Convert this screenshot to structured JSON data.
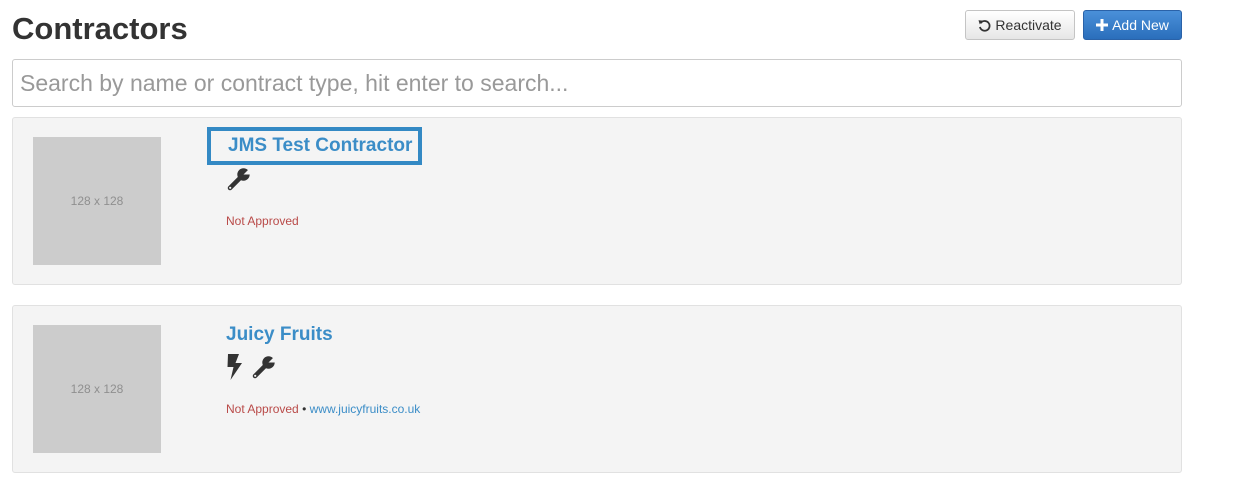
{
  "header": {
    "title": "Contractors",
    "reactivate_label": "Reactivate",
    "add_new_label": "Add New"
  },
  "search": {
    "placeholder": "Search by name or contract type, hit enter to search...",
    "value": ""
  },
  "contractors": [
    {
      "thumbnail_text": "128 x 128",
      "name": "JMS Test Contractor",
      "trade_icons": [
        "wrench-icon"
      ],
      "status": "Not Approved",
      "website": ""
    },
    {
      "thumbnail_text": "128 x 128",
      "name": "Juicy Fruits",
      "trade_icons": [
        "lightning-icon",
        "wrench-icon"
      ],
      "status": "Not Approved",
      "separator": "•",
      "website": "www.juicyfruits.co.uk"
    }
  ],
  "colors": {
    "link": "#3b8dc7",
    "status_not_approved": "#b94a48",
    "primary_button": "#2a6ebb",
    "focus_outline": "#3389c4"
  }
}
